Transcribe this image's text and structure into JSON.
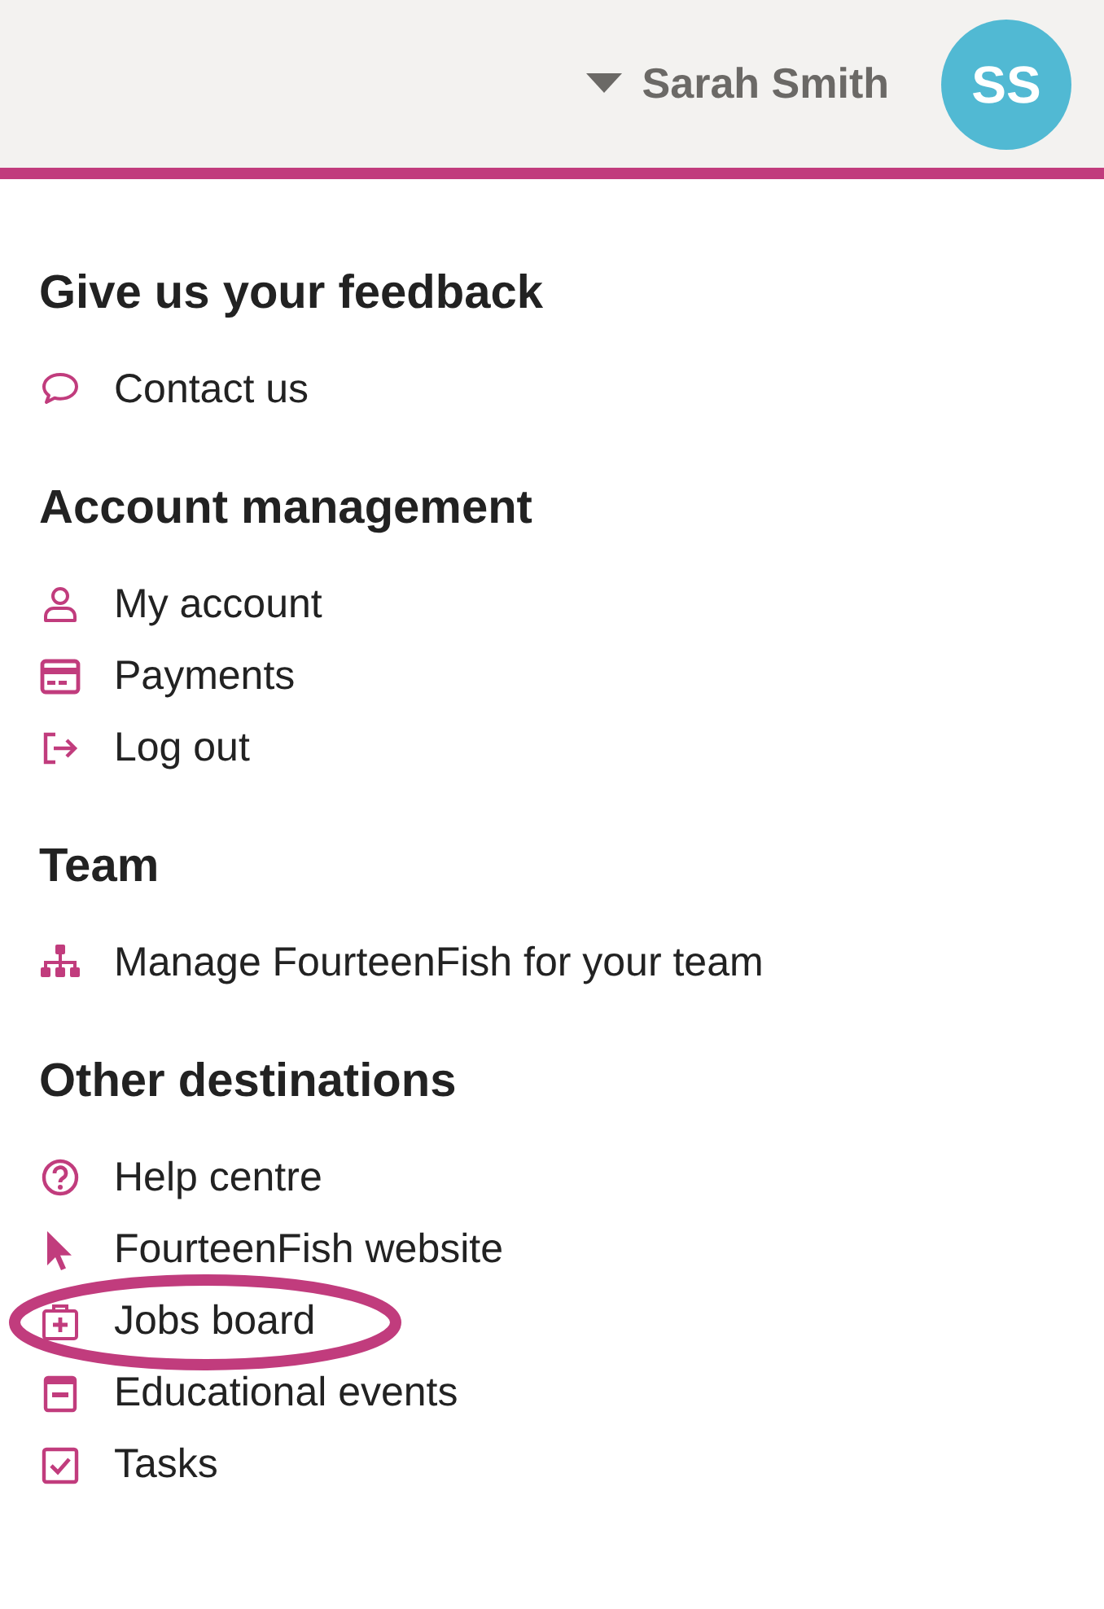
{
  "header": {
    "user_name": "Sarah Smith",
    "avatar_initials": "SS"
  },
  "sections": [
    {
      "heading": "Give us your feedback",
      "items": [
        {
          "label": "Contact us",
          "kind": "chat",
          "circled": false
        }
      ]
    },
    {
      "heading": "Account management",
      "items": [
        {
          "label": "My account",
          "kind": "user",
          "circled": false
        },
        {
          "label": "Payments",
          "kind": "card",
          "circled": false
        },
        {
          "label": "Log out",
          "kind": "logout",
          "circled": false
        }
      ]
    },
    {
      "heading": "Team",
      "items": [
        {
          "label": "Manage FourteenFish for your team",
          "kind": "org",
          "circled": false
        }
      ]
    },
    {
      "heading": "Other destinations",
      "items": [
        {
          "label": "Help centre",
          "kind": "help",
          "circled": false
        },
        {
          "label": "FourteenFish website",
          "kind": "cursor",
          "circled": false
        },
        {
          "label": "Jobs board",
          "kind": "medkit",
          "circled": true
        },
        {
          "label": "Educational events",
          "kind": "calendar",
          "circled": false
        },
        {
          "label": "Tasks",
          "kind": "checkbox",
          "circled": false
        }
      ]
    }
  ]
}
